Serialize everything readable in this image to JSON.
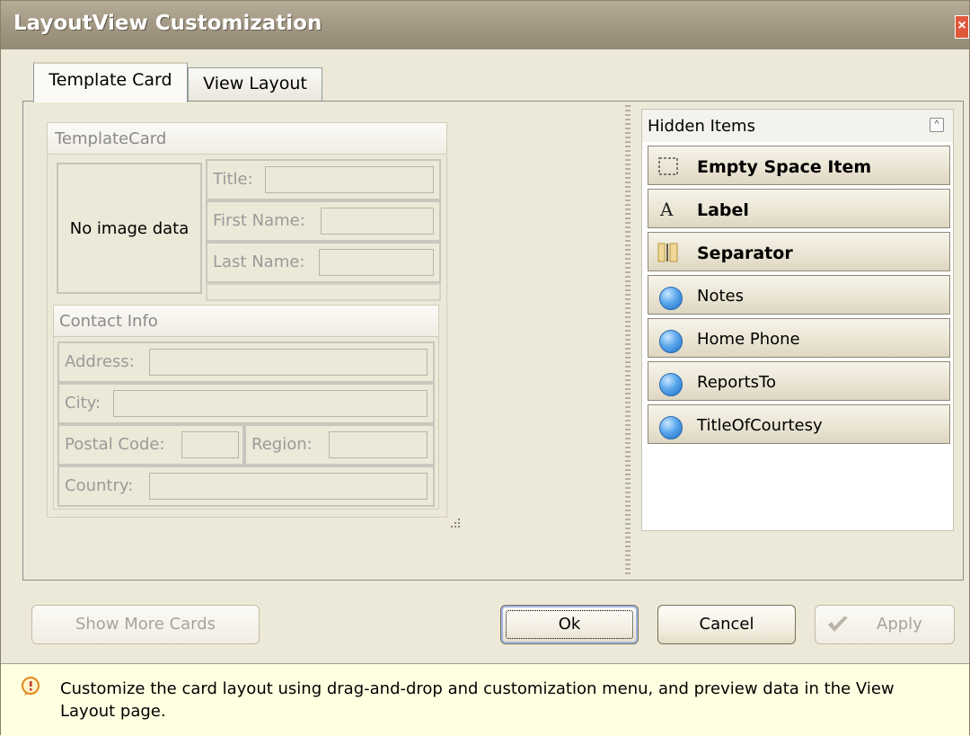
{
  "window": {
    "title": "LayoutView Customization",
    "close_glyph": "×"
  },
  "tabs": [
    {
      "label": "Template Card",
      "active": true
    },
    {
      "label": "View Layout",
      "active": false
    }
  ],
  "template_card": {
    "header": "TemplateCard",
    "image_placeholder": "No image data",
    "fields": {
      "title": "Title:",
      "first_name": "First Name:",
      "last_name": "Last Name:"
    },
    "contact_info": {
      "header": "Contact Info",
      "fields": {
        "address": "Address:",
        "city": "City:",
        "postal_code": "Postal Code:",
        "region": "Region:",
        "country": "Country:"
      }
    }
  },
  "hidden_items": {
    "title": "Hidden Items",
    "collapse_glyph": "^",
    "items": [
      {
        "label": "Empty Space Item",
        "icon": "empty-space-icon",
        "bold": true
      },
      {
        "label": "Label",
        "icon": "label-icon",
        "bold": true
      },
      {
        "label": "Separator",
        "icon": "separator-icon",
        "bold": true
      },
      {
        "label": "Notes",
        "icon": "field-icon",
        "bold": false
      },
      {
        "label": "Home Phone",
        "icon": "field-icon",
        "bold": false
      },
      {
        "label": "ReportsTo",
        "icon": "field-icon",
        "bold": false
      },
      {
        "label": "TitleOfCourtesy",
        "icon": "field-icon",
        "bold": false
      }
    ]
  },
  "buttons": {
    "show_more_cards": "Show More Cards",
    "ok": "Ok",
    "cancel": "Cancel",
    "apply": "Apply"
  },
  "hint": {
    "text": "Customize the card layout using drag-and-drop and customization menu, and preview data in the View Layout page."
  },
  "colors": {
    "window_bg": "#ece9d8",
    "titlebar": "#a49a85",
    "hint_bg": "#ffffe1",
    "field_dot": "#3b8ee0"
  }
}
